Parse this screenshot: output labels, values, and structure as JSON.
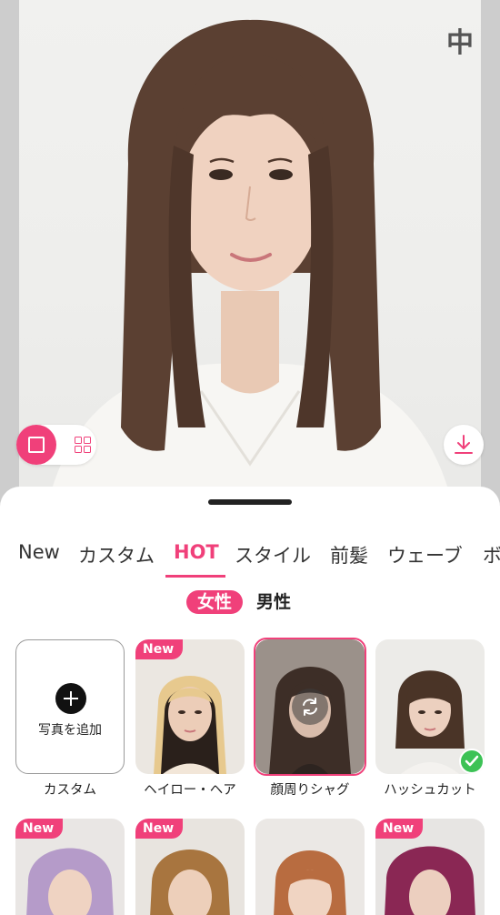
{
  "top_bar": {
    "lang_button_label": "中"
  },
  "view_toggle": {
    "single_icon": "square-icon",
    "grid_icon": "grid-icon"
  },
  "download": {
    "icon": "download-icon"
  },
  "tabs": [
    {
      "label": "New",
      "active": false
    },
    {
      "label": "カスタム",
      "active": false
    },
    {
      "label": "HOT",
      "active": true
    },
    {
      "label": "スタイル",
      "active": false
    },
    {
      "label": "前髪",
      "active": false
    },
    {
      "label": "ウェーブ",
      "active": false
    },
    {
      "label": "ボ",
      "active": false
    }
  ],
  "gender": {
    "female": "女性",
    "male": "男性",
    "selected": "女性"
  },
  "custom_card": {
    "add_text": "写真を追加",
    "label": "カスタム"
  },
  "styles": [
    {
      "label": "ヘイロー・ヘア",
      "badge": "New",
      "selected": false,
      "checked": false,
      "hair_color": "#e7c98e"
    },
    {
      "label": "顔周りシャグ",
      "badge": "",
      "selected": true,
      "checked": false,
      "hair_color": "#3d2e27"
    },
    {
      "label": "ハッシュカット",
      "badge": "",
      "selected": false,
      "checked": true,
      "hair_color": "#4a3427"
    }
  ],
  "styles_row2": [
    {
      "badge": "New",
      "hair_color": "#b59bc9"
    },
    {
      "badge": "New",
      "hair_color": "#a8753f"
    },
    {
      "badge": "",
      "hair_color": "#b86c40"
    },
    {
      "badge": "New",
      "hair_color": "#8a2754"
    }
  ],
  "colors": {
    "accent": "#f0407a",
    "check": "#3cc255"
  }
}
